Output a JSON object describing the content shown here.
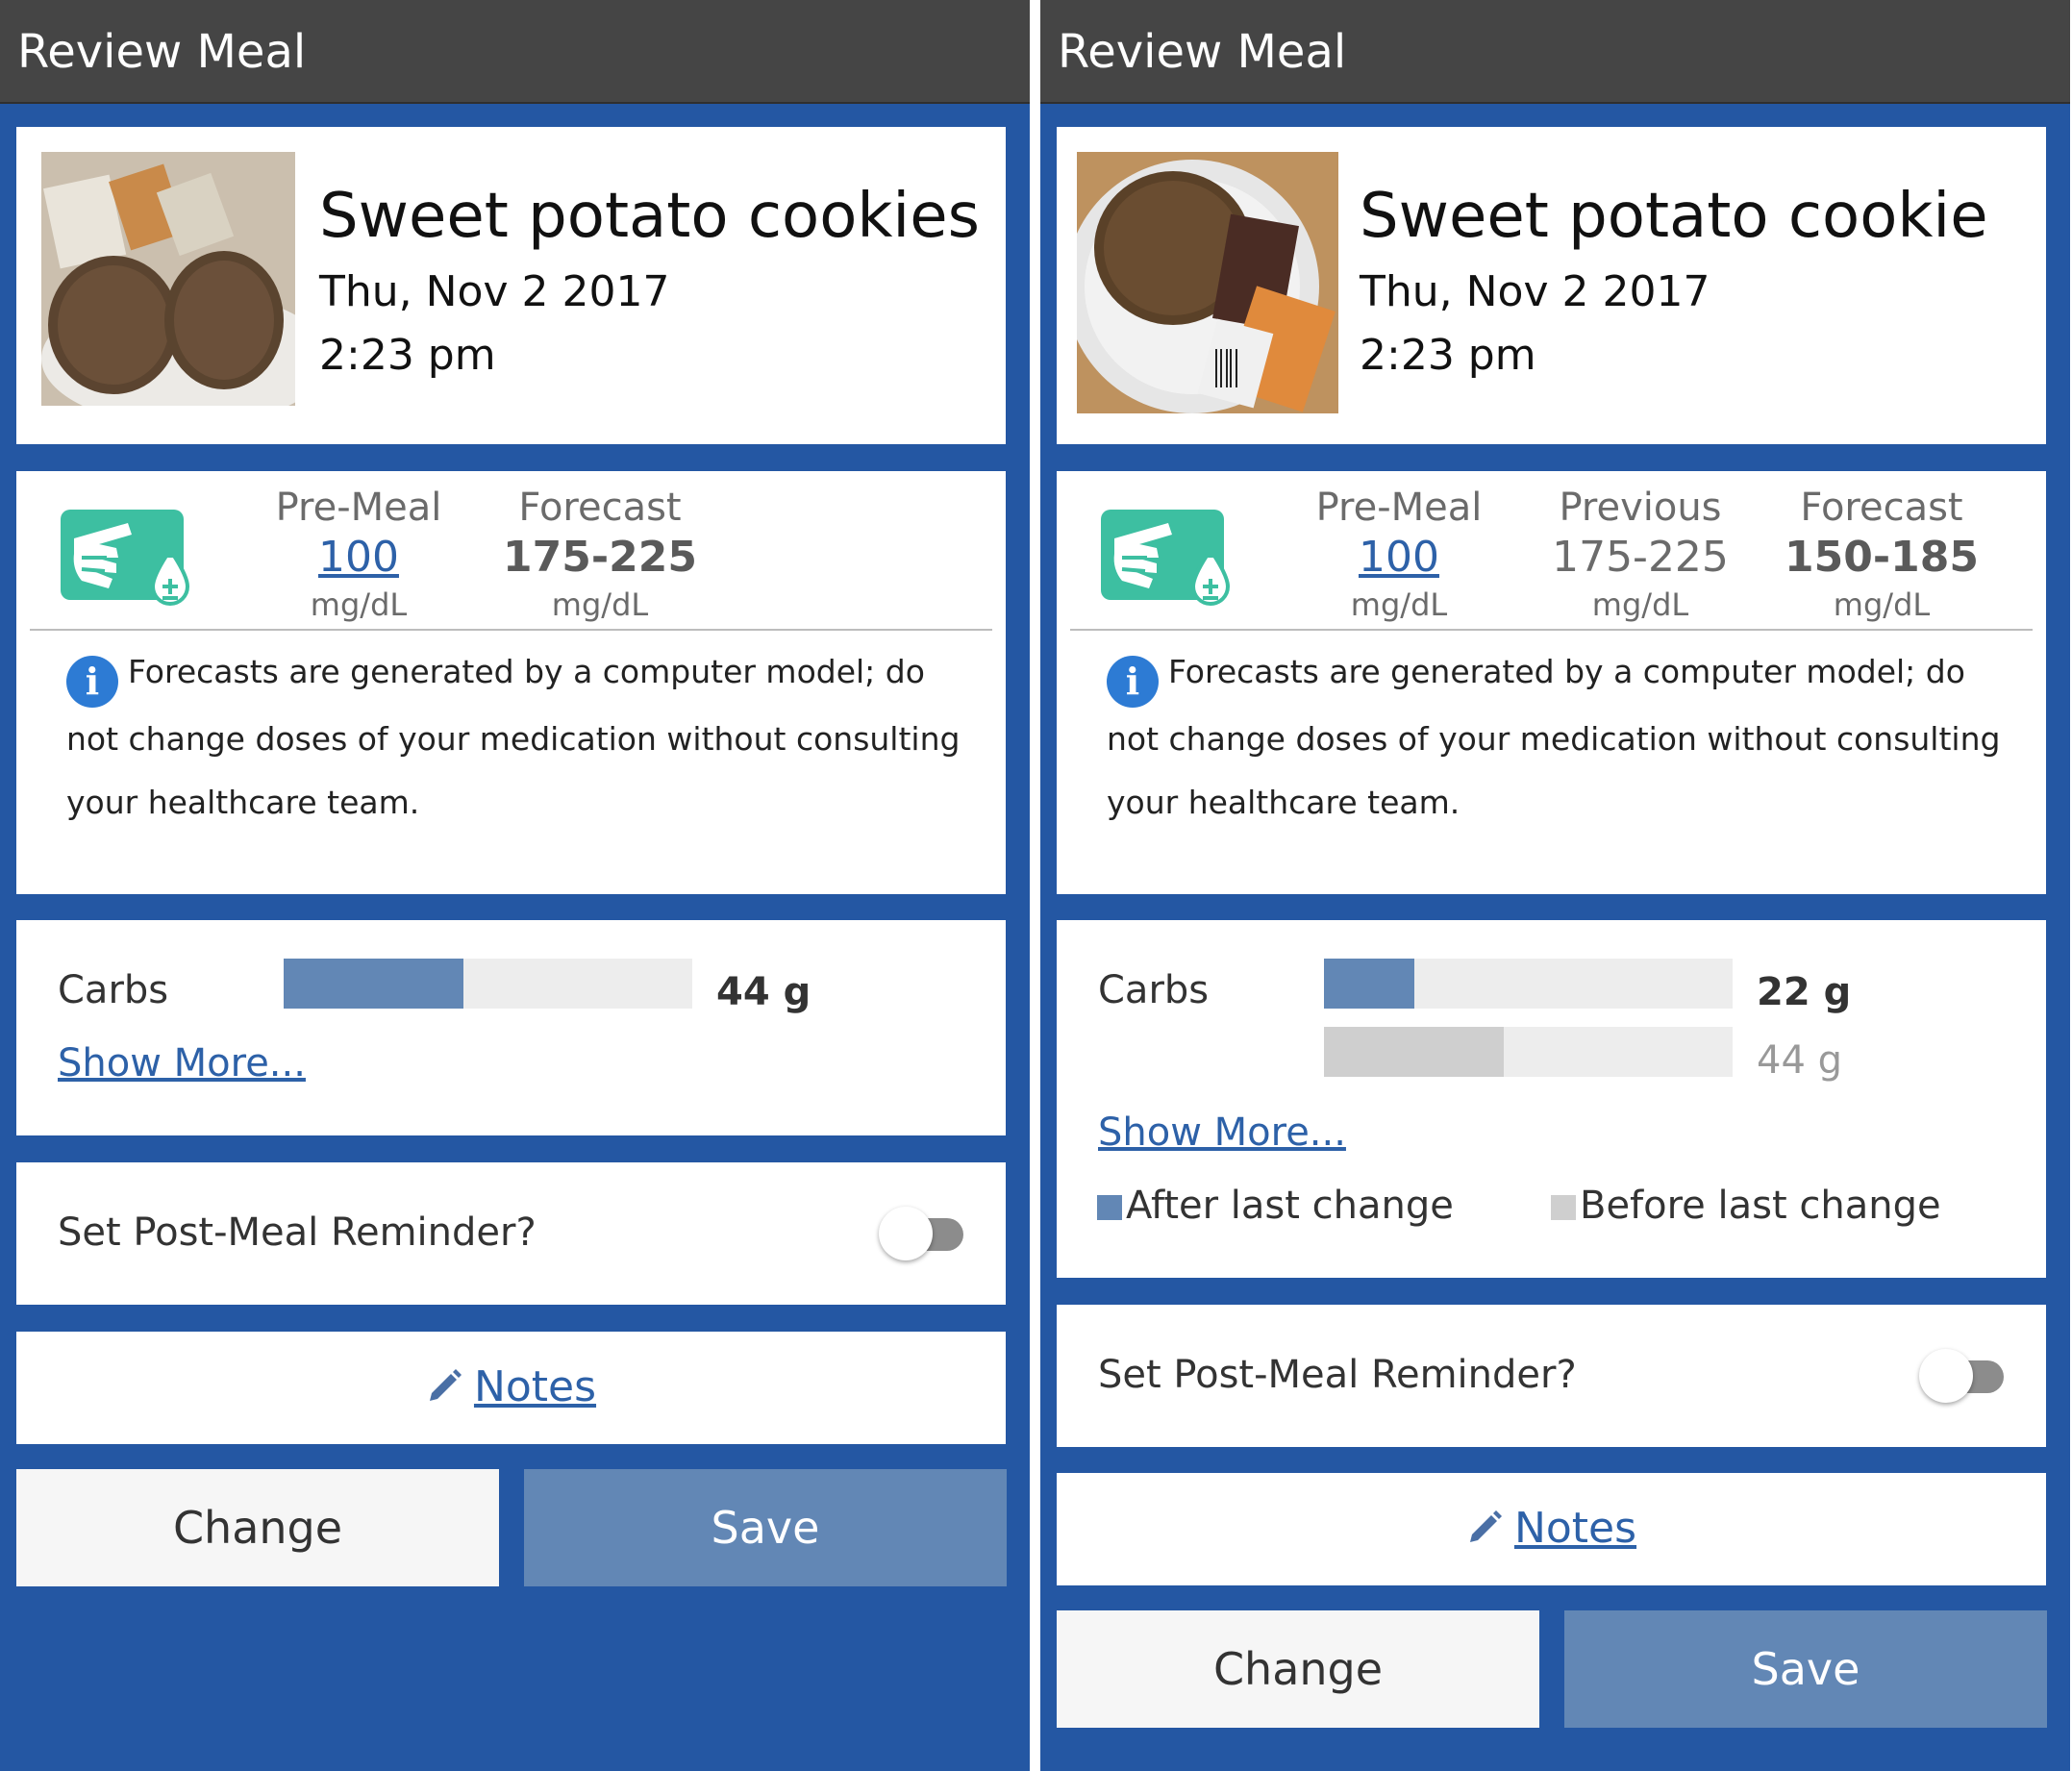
{
  "left": {
    "app_bar": {
      "title": "Review Meal"
    },
    "meal": {
      "name": "Sweet potato cookies",
      "date": "Thu, Nov 2 2017",
      "time": "2:23 pm"
    },
    "glucose": {
      "stats": [
        {
          "label": "Pre-Meal",
          "value": "100",
          "unit": "mg/dL"
        },
        {
          "label": "Forecast",
          "value": "175-225",
          "unit": "mg/dL"
        }
      ],
      "info_icon_glyph": "i",
      "disclaimer": "Forecasts are generated by a computer model; do not change doses of your medication without consulting your healthcare team."
    },
    "carbs": {
      "label": "Carbs",
      "value": "44 g",
      "value_grams": 44,
      "bar_fraction": 0.44,
      "show_more": "Show More..."
    },
    "reminder": {
      "label": "Set Post-Meal Reminder?",
      "enabled": false
    },
    "notes": {
      "label": "Notes"
    },
    "buttons": {
      "change": "Change",
      "save": "Save"
    }
  },
  "right": {
    "app_bar": {
      "title": "Review Meal"
    },
    "meal": {
      "name": "Sweet potato cookie",
      "date": "Thu, Nov 2 2017",
      "time": "2:23 pm"
    },
    "glucose": {
      "stats": [
        {
          "label": "Pre-Meal",
          "value": "100",
          "unit": "mg/dL"
        },
        {
          "label": "Previous",
          "value": "175-225",
          "unit": "mg/dL"
        },
        {
          "label": "Forecast",
          "value": "150-185",
          "unit": "mg/dL"
        }
      ],
      "info_icon_glyph": "i",
      "disclaimer": "Forecasts are generated by a computer model; do not change doses of your medication without consulting your healthcare team."
    },
    "carbs": {
      "label": "Carbs",
      "value": "22 g",
      "value_grams": 22,
      "bar_fraction": 0.22,
      "previous_value": "44 g",
      "previous_value_grams": 44,
      "previous_bar_fraction": 0.44,
      "show_more": "Show More...",
      "legend": {
        "after": "After last change",
        "before": "Before last change"
      }
    },
    "reminder": {
      "label": "Set Post-Meal Reminder?",
      "enabled": false
    },
    "notes": {
      "label": "Notes"
    },
    "buttons": {
      "change": "Change",
      "save": "Save"
    }
  },
  "colors": {
    "background_blue": "#2457a3",
    "app_bar": "#454545",
    "accent_link": "#2d61a8",
    "bar_after": "#6287b5",
    "bar_before": "#cfcfcf",
    "icon_teal": "#3dbfa1"
  },
  "icons": {
    "glucose": "glucose-meter-icon",
    "info": "info-icon",
    "notes": "pencil-icon"
  }
}
